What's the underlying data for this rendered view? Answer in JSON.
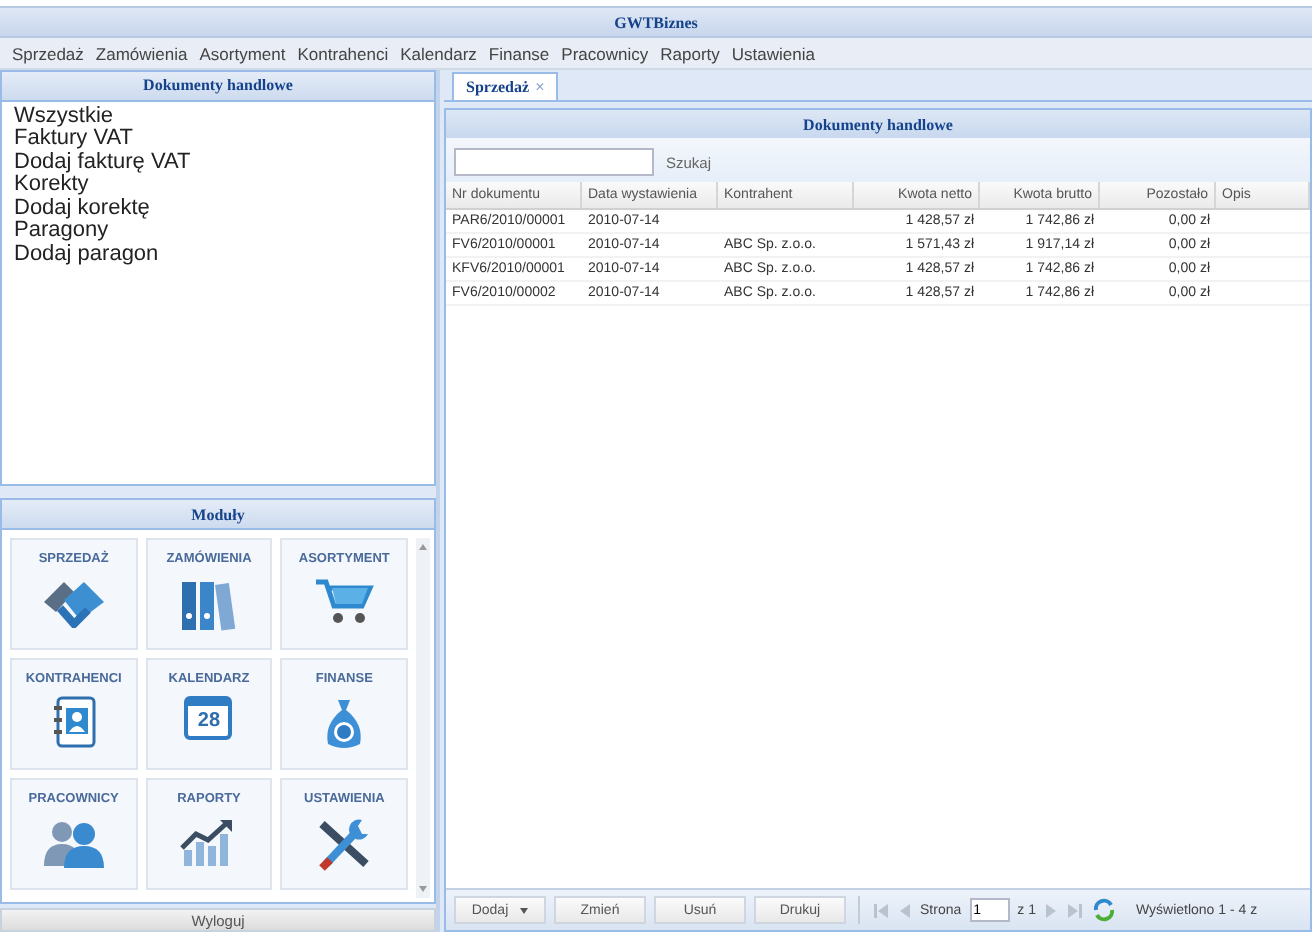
{
  "window": {
    "title": "GWTBiznes"
  },
  "menu": [
    "Sprzedaż",
    "Zamówienia",
    "Asortyment",
    "Kontrahenci",
    "Kalendarz",
    "Finanse",
    "Pracownicy",
    "Raporty",
    "Ustawienia"
  ],
  "sidebar": {
    "title": "Dokumenty handlowe",
    "items": [
      "Wszystkie",
      "Faktury VAT",
      "Dodaj fakturę VAT",
      "Korekty",
      "Dodaj korektę",
      "Paragony",
      "Dodaj paragon"
    ]
  },
  "modules": {
    "title": "Moduły",
    "tiles": [
      {
        "label": "SPRZEDAŻ"
      },
      {
        "label": "ZAMÓWIENIA"
      },
      {
        "label": "ASORTYMENT"
      },
      {
        "label": "KONTRAHENCI"
      },
      {
        "label": "KALENDARZ",
        "badge": "28"
      },
      {
        "label": "FINANSE"
      },
      {
        "label": "PRACOWNICY"
      },
      {
        "label": "RAPORTY"
      },
      {
        "label": "USTAWIENIA"
      }
    ],
    "logout": "Wyloguj"
  },
  "tabs": [
    {
      "label": "Sprzedaż",
      "close": "×",
      "selected": true
    }
  ],
  "panel": {
    "title": "Dokumenty handlowe",
    "search": {
      "button": "Szukaj"
    },
    "table": {
      "columns": [
        "Nr dokumentu",
        "Data wystawienia",
        "Kontrahent",
        "Kwota netto",
        "Kwota brutto",
        "Pozostało",
        "Opis"
      ],
      "rows": [
        [
          "PAR6/2010/00001",
          "2010-07-14",
          null,
          "1 428,57 zł",
          "1 742,86 zł",
          "0,00 zł",
          null
        ],
        [
          "FV6/2010/00001",
          "2010-07-14",
          "ABC Sp. z.o.o.",
          "1 571,43 zł",
          "1 917,14 zł",
          "0,00 zł",
          null
        ],
        [
          "KFV6/2010/00001",
          "2010-07-14",
          "ABC Sp. z.o.o.",
          "1 428,57 zł",
          "1 742,86 zł",
          "0,00 zł",
          null
        ],
        [
          "FV6/2010/00002",
          "2010-07-14",
          "ABC Sp. z.o.o.",
          "1 428,57 zł",
          "1 742,86 zł",
          "0,00 zł",
          null
        ]
      ]
    },
    "toolbar": {
      "buttons": [
        "Dodaj",
        "Zmień",
        "Usuń",
        "Drukuj"
      ],
      "page_label": "Strona",
      "page": "1",
      "page_total": "z 1",
      "status": "Wyświetlono 1 - 4 z"
    }
  }
}
